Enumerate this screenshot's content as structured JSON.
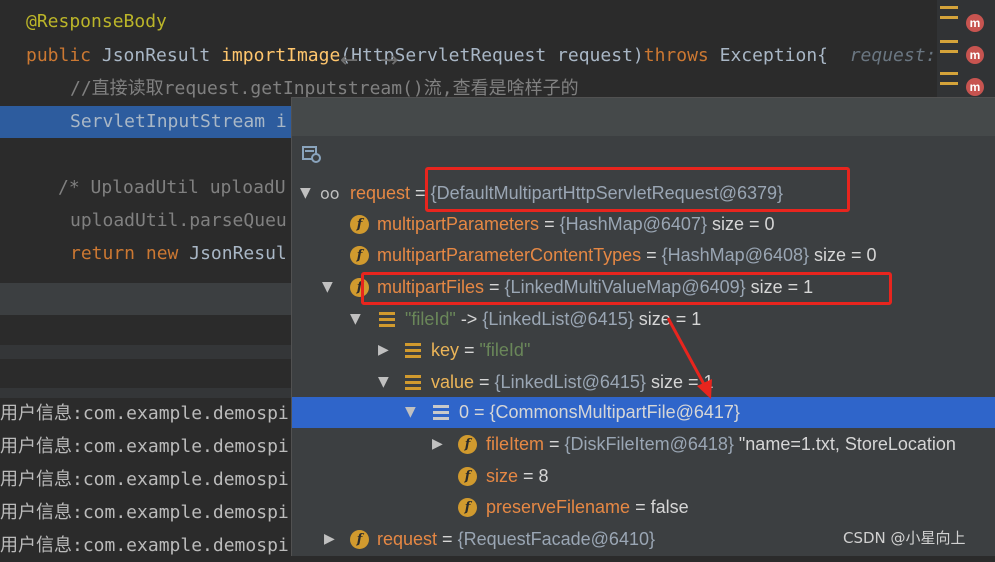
{
  "code": {
    "annotation": "@ResponseBody",
    "line2": {
      "public": "public",
      "type": "JsonResult",
      "method": "importImage",
      "params": "(HttpServletRequest request)",
      "throws": "throws",
      "rest": " Exception{",
      "hint": "request:"
    },
    "comment1": "//直接读取request.getInputstream()流,查看是啥样子的",
    "line4": "ServletInputStream i",
    "comment2": "/* UploadUtil uploadU",
    "line6": "uploadUtil.parseQueu",
    "line7": {
      "kw1": "return",
      "kw2": "new",
      "rest": "JsonResul"
    },
    "brace": "}"
  },
  "gutter": {
    "marker_letter": "m"
  },
  "log_lines": [
    "用户信息:com.example.demospi",
    "用户信息:com.example.demospi",
    "用户信息:com.example.demospi",
    "用户信息:com.example.demospi",
    "用户信息:com.example.demospi"
  ],
  "toolbar": {
    "back": "←",
    "forward": "→"
  },
  "tree": [
    {
      "name": "request",
      "sep": " = ",
      "value": "{DefaultMultipartHttpServletRequest@6379}",
      "extra": ""
    },
    {
      "name": "multipartParameters",
      "sep": " = ",
      "value": "{HashMap@6407}",
      "extra": "  size = 0"
    },
    {
      "name": "multipartParameterContentTypes",
      "sep": " = ",
      "value": "{HashMap@6408}",
      "extra": "  size = 0"
    },
    {
      "name": "multipartFiles",
      "sep": " = ",
      "value": "{LinkedMultiValueMap@6409}",
      "extra": "  size = 1"
    },
    {
      "name": "\"fileId\"",
      "sep": " -> ",
      "value": "{LinkedList@6415}",
      "extra": "  size = 1"
    },
    {
      "name": "key",
      "sep": " = ",
      "value": "\"fileId\"",
      "extra": ""
    },
    {
      "name": "value",
      "sep": " = ",
      "value": "{LinkedList@6415}",
      "extra": "  size = 1"
    },
    {
      "name": "0",
      "sep": " = ",
      "value": "{CommonsMultipartFile@6417}",
      "extra": ""
    },
    {
      "name": "fileItem",
      "sep": " = ",
      "value": "{DiskFileItem@6418}",
      "extra": " \"name=1.txt, StoreLocation"
    },
    {
      "name": "size",
      "sep": " = ",
      "value": "8",
      "extra": ""
    },
    {
      "name": "preserveFilename",
      "sep": " = ",
      "value": "false",
      "extra": ""
    },
    {
      "name": "request",
      "sep": " = ",
      "value": "{RequestFacade@6410}",
      "extra": ""
    }
  ],
  "watermark": "CSDN @小星向上",
  "colors": {
    "highlight_line": "#2d5c9e",
    "selected_row": "#2f65ca",
    "red_box": "#e8251e",
    "field_icon": "#d19a2e"
  }
}
